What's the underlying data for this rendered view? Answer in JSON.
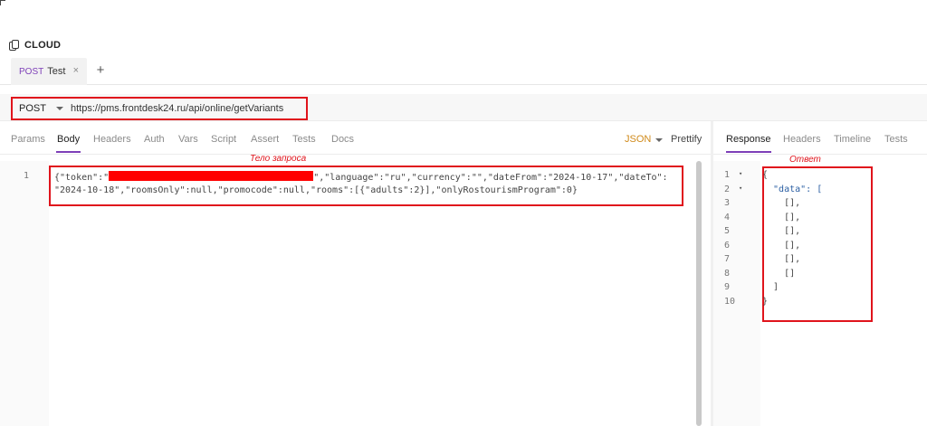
{
  "collection": {
    "name": "CLOUD",
    "icon": "copy-icon"
  },
  "tabs": [
    {
      "method": "POST",
      "name": "Test",
      "close": "×"
    }
  ],
  "add_tab": "+",
  "request": {
    "method": "POST",
    "url": "https://pms.frontdesk24.ru/api/online/getVariants"
  },
  "request_tabs": [
    "Params",
    "Body",
    "Headers",
    "Auth",
    "Vars",
    "Script",
    "Assert",
    "Tests",
    "Docs"
  ],
  "active_request_tab": "Body",
  "body_format": "JSON",
  "prettify": "Prettify",
  "body_annotation": "Тело запроса",
  "body": {
    "line_number": "1",
    "line1_a": "{\"token\":\"",
    "line1_b": "\",\"language\":\"ru\",\"currency\":\"\",\"dateFrom\":\"2024-10-17\",\"dateTo\":",
    "line2": "\"2024-10-18\",\"roomsOnly\":null,\"promocode\":null,\"rooms\":[{\"adults\":2}],\"onlyRostourismProgram\":0}"
  },
  "response_tabs": [
    "Response",
    "Headers",
    "Timeline",
    "Tests"
  ],
  "active_response_tab": "Response",
  "response_annotation": "Ответ",
  "response": {
    "lines": [
      {
        "n": "1",
        "fold": "▾",
        "text": "{"
      },
      {
        "n": "2",
        "fold": "▾",
        "text": "  \"data\": ["
      },
      {
        "n": "3",
        "fold": "",
        "text": "    [],"
      },
      {
        "n": "4",
        "fold": "",
        "text": "    [],"
      },
      {
        "n": "5",
        "fold": "",
        "text": "    [],"
      },
      {
        "n": "6",
        "fold": "",
        "text": "    [],"
      },
      {
        "n": "7",
        "fold": "",
        "text": "    [],"
      },
      {
        "n": "8",
        "fold": "",
        "text": "    []"
      },
      {
        "n": "9",
        "fold": "",
        "text": "  ]"
      },
      {
        "n": "10",
        "fold": "",
        "text": "}"
      }
    ]
  },
  "colors": {
    "accent": "#7d3fb8",
    "annotation": "#e0141c",
    "json_format": "#d08a1a"
  }
}
